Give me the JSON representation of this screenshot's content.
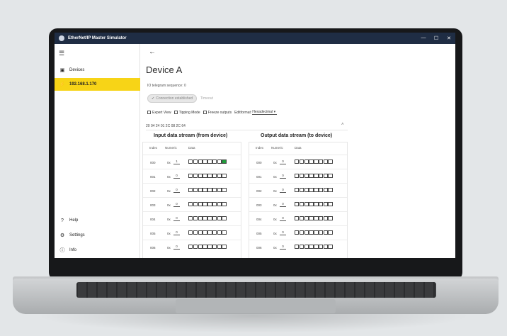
{
  "window": {
    "title": "EtherNet/IP Master Simulator",
    "controls": [
      "—",
      "☐",
      "✕"
    ]
  },
  "sidebar": {
    "items": [
      {
        "label": "Devices",
        "icon": "devices-icon"
      },
      {
        "label": "192.168.1.170",
        "icon": "connection-icon",
        "active": true
      }
    ],
    "bottom_items": [
      {
        "label": "Help",
        "icon": "help-icon"
      },
      {
        "label": "Settings",
        "icon": "gear-icon"
      },
      {
        "label": "Info",
        "icon": "info-icon"
      }
    ]
  },
  "device": {
    "title": "Device A",
    "telegram_sequence_label": "IO telegram sequence: 0",
    "connection_status": "Connection established",
    "timeout_label": "Timeout",
    "options": {
      "expert_view": "Expert View",
      "tipping_mode": "Tipping Mode",
      "freeze_outputs": "Freeze outputs"
    },
    "edit_format_label": "Editformat:",
    "edit_format_value": "Hexadecimal",
    "hex_summary": "20 04 24 01 2C 08 2C 64"
  },
  "streams": {
    "input": {
      "title": "Input data stream (from device)",
      "headers": [
        "Index",
        "Numeric",
        "Data"
      ],
      "prefix": "0x",
      "rows": [
        {
          "index": "000",
          "value": "1",
          "bits": [
            0,
            0,
            0,
            0,
            0,
            0,
            0,
            1
          ]
        },
        {
          "index": "001",
          "value": "0",
          "bits": [
            0,
            0,
            0,
            0,
            0,
            0,
            0,
            0
          ]
        },
        {
          "index": "002",
          "value": "0",
          "bits": [
            0,
            0,
            0,
            0,
            0,
            0,
            0,
            0
          ]
        },
        {
          "index": "003",
          "value": "0",
          "bits": [
            0,
            0,
            0,
            0,
            0,
            0,
            0,
            0
          ]
        },
        {
          "index": "004",
          "value": "0",
          "bits": [
            0,
            0,
            0,
            0,
            0,
            0,
            0,
            0
          ]
        },
        {
          "index": "005",
          "value": "0",
          "bits": [
            0,
            0,
            0,
            0,
            0,
            0,
            0,
            0
          ]
        },
        {
          "index": "006",
          "value": "0",
          "bits": [
            0,
            0,
            0,
            0,
            0,
            0,
            0,
            0
          ]
        }
      ]
    },
    "output": {
      "title": "Output data stream (to device)",
      "headers": [
        "Index",
        "Numeric",
        "Data"
      ],
      "prefix": "0x",
      "rows": [
        {
          "index": "000",
          "value": "0",
          "bits": [
            0,
            0,
            0,
            0,
            0,
            0,
            0,
            0
          ]
        },
        {
          "index": "001",
          "value": "0",
          "bits": [
            0,
            0,
            0,
            0,
            0,
            0,
            0,
            0
          ]
        },
        {
          "index": "002",
          "value": "0",
          "bits": [
            0,
            0,
            0,
            0,
            0,
            0,
            0,
            0
          ]
        },
        {
          "index": "003",
          "value": "0",
          "bits": [
            0,
            0,
            0,
            0,
            0,
            0,
            0,
            0
          ]
        },
        {
          "index": "004",
          "value": "0",
          "bits": [
            0,
            0,
            0,
            0,
            0,
            0,
            0,
            0
          ]
        },
        {
          "index": "005",
          "value": "0",
          "bits": [
            0,
            0,
            0,
            0,
            0,
            0,
            0,
            0
          ]
        },
        {
          "index": "006",
          "value": "0",
          "bits": [
            0,
            0,
            0,
            0,
            0,
            0,
            0,
            0
          ]
        }
      ]
    }
  },
  "colors": {
    "titlebar": "#1f2d44",
    "active_nav": "#f7d417",
    "bit_on": "#1f9d3a"
  }
}
